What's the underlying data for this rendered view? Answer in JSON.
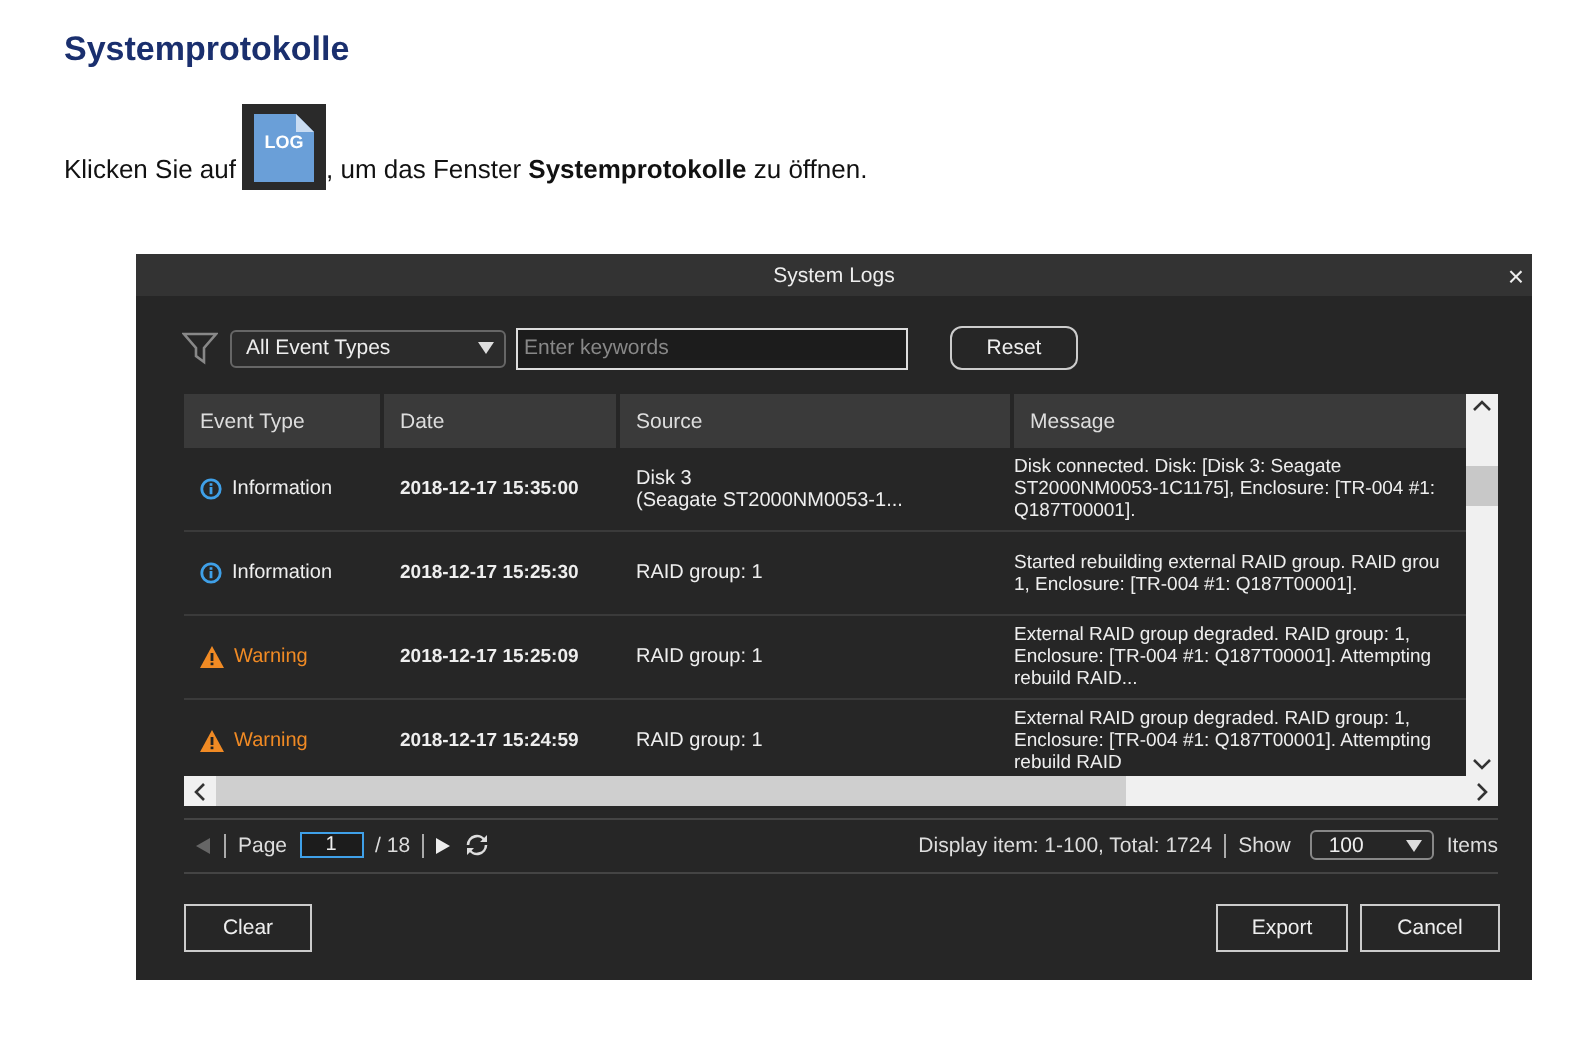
{
  "heading": "Systemprotokolle",
  "instruction": {
    "before": "Klicken Sie auf",
    "after": ", um das Fenster **Systemprotokolle** zu öffnen.",
    "icon_label": "LOG"
  },
  "window": {
    "title": "System Logs",
    "close": "×"
  },
  "filter": {
    "event_type": "All Event Types",
    "search_placeholder": "Enter keywords",
    "reset": "Reset"
  },
  "table": {
    "columns": [
      "Event Type",
      "Date",
      "Source",
      "Message"
    ],
    "rows": [
      {
        "kind": "information",
        "type": "Information",
        "date": "2018-12-17 15:35:00",
        "source": "Disk 3\n(Seagate ST2000NM0053-1...",
        "message": "Disk connected. Disk: [Disk 3: Seagate\nST2000NM0053-1C1175], Enclosure: [TR-004 #1:\nQ187T00001]."
      },
      {
        "kind": "information",
        "type": "Information",
        "date": "2018-12-17 15:25:30",
        "source": "RAID group: 1",
        "message": "Started rebuilding external RAID group. RAID grou\n1, Enclosure: [TR-004 #1: Q187T00001]."
      },
      {
        "kind": "warning",
        "type": "Warning",
        "date": "2018-12-17 15:25:09",
        "source": "RAID group: 1",
        "message": "External RAID group degraded. RAID group: 1,\nEnclosure: [TR-004 #1: Q187T00001]. Attempting\nrebuild RAID..."
      },
      {
        "kind": "warning",
        "type": "Warning",
        "date": "2018-12-17 15:24:59",
        "source": "RAID group: 1",
        "message": "External RAID group degraded. RAID group: 1,\nEnclosure: [TR-004 #1: Q187T00001]. Attempting\nrebuild RAID"
      }
    ]
  },
  "pagination": {
    "page_label": "Page",
    "page": "1",
    "total_pages": "/ 18",
    "prev_disabled": true,
    "display": "Display item: 1-100, Total: 1724",
    "show_label": "Show",
    "per_page": "100",
    "items_label": "Items"
  },
  "buttons": {
    "clear": "Clear",
    "export": "Export",
    "cancel": "Cancel"
  }
}
